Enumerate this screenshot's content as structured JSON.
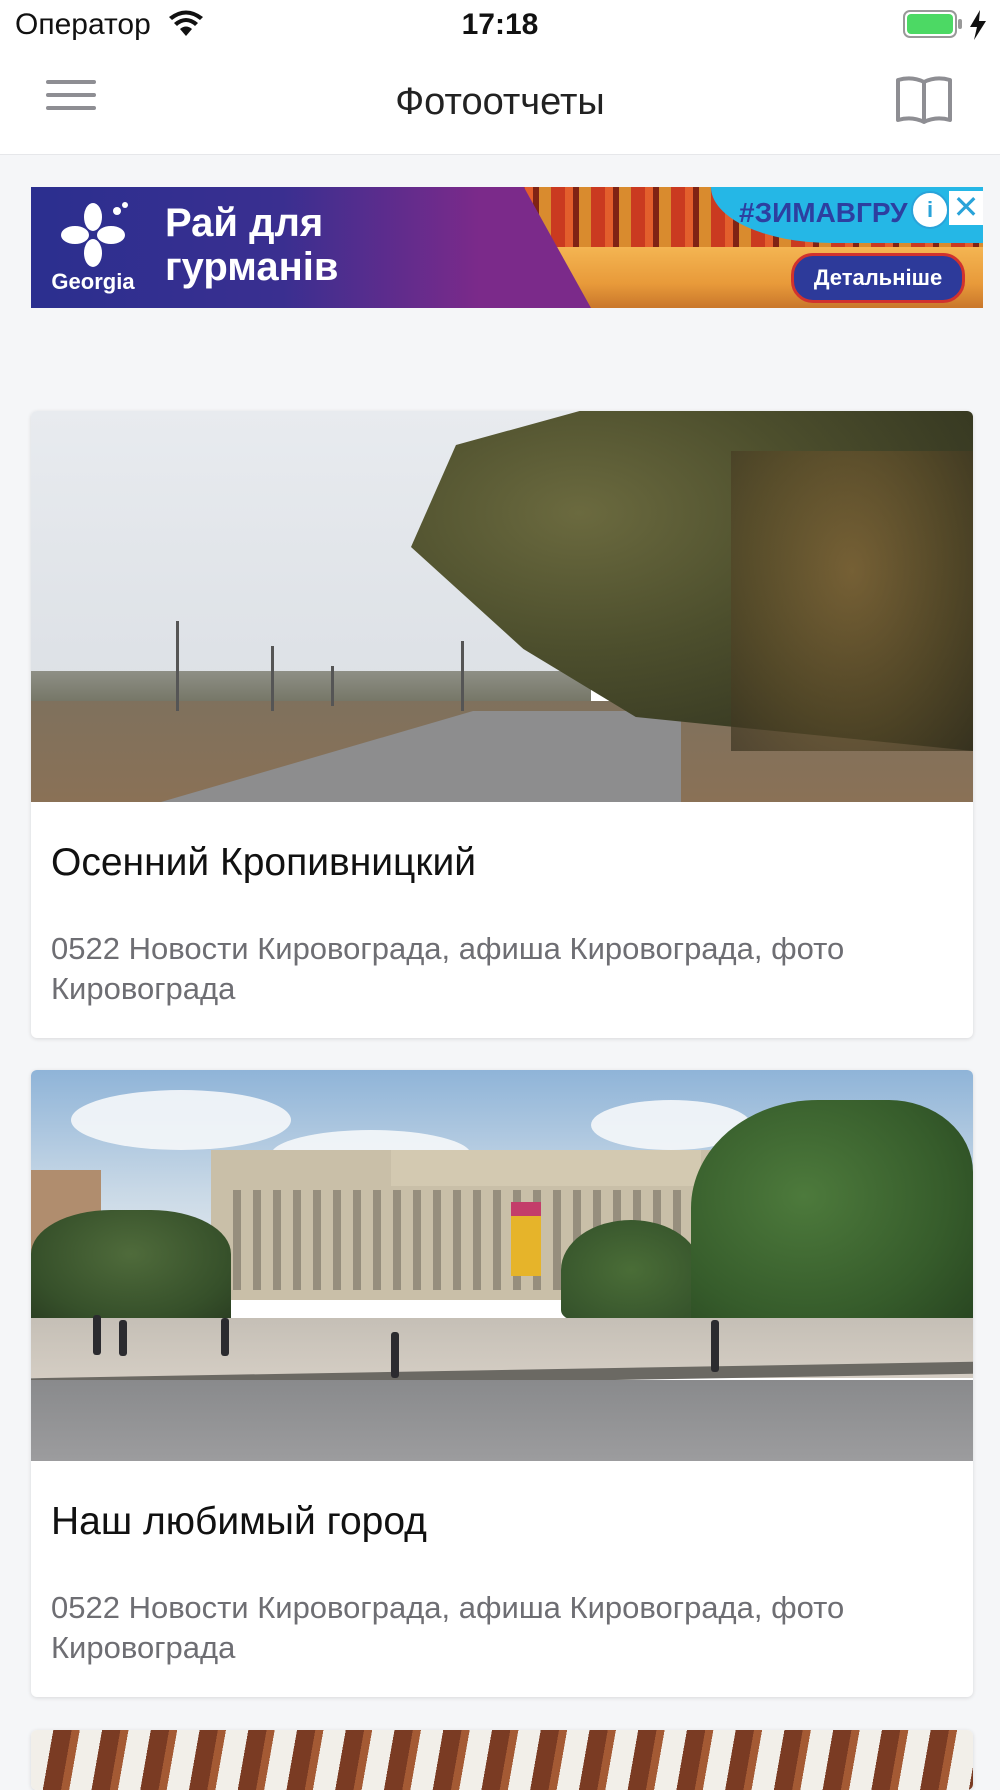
{
  "status_bar": {
    "carrier": "Оператор",
    "time": "17:18",
    "battery_color": "#4cd964"
  },
  "nav": {
    "title": "Фотоотчеты",
    "menu_icon": "hamburger-menu-icon",
    "right_icon": "book-icon"
  },
  "ad": {
    "logo_text": "Georgia",
    "headline": "Рай для гурманів",
    "hashtag": "#ЗИМАВГРУ",
    "cta": "Детальніше",
    "info_icon": "info-icon",
    "close_icon": "close-icon",
    "accent": "#2d3a9a"
  },
  "cards": [
    {
      "title": "Осенний Кропивницкий",
      "description": "0522 Новости Кировограда, афиша Кировограда, фото Кировограда",
      "image": "autumn-road-photo"
    },
    {
      "title": "Наш любимый город",
      "description": "0522 Новости Кировограда, афиша Кировограда, фото Кировограда",
      "image": "city-square-photo"
    },
    {
      "image": "partial-photo"
    }
  ]
}
